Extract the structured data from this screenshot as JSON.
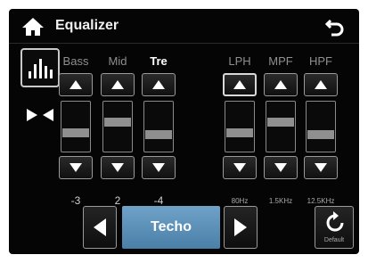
{
  "header": {
    "title": "Equalizer"
  },
  "bands": [
    {
      "label": "Bass",
      "value": "-3",
      "level": 0.35,
      "active": false
    },
    {
      "label": "Mid",
      "value": "2",
      "level": 0.6,
      "active": false
    },
    {
      "label": "Tre",
      "value": "-4",
      "level": 0.3,
      "active": true
    },
    {
      "label": "LPH",
      "value": "80Hz",
      "level": 0.35,
      "active": false
    },
    {
      "label": "MPF",
      "value": "1.5KHz",
      "level": 0.6,
      "active": false
    },
    {
      "label": "HPF",
      "value": "12.5KHz",
      "level": 0.3,
      "active": false
    }
  ],
  "preset": {
    "label": "Techo"
  },
  "default_button": {
    "label": "Default"
  },
  "colors": {
    "background": "#050505",
    "preset": "#5b8fb8",
    "thumb": "#8f8f8f"
  },
  "icons": {
    "home": "home-icon",
    "back": "back-arrow-icon",
    "eq": "equalizer-bars-icon",
    "balance": "balance-icon",
    "reset": "reset-icon"
  }
}
